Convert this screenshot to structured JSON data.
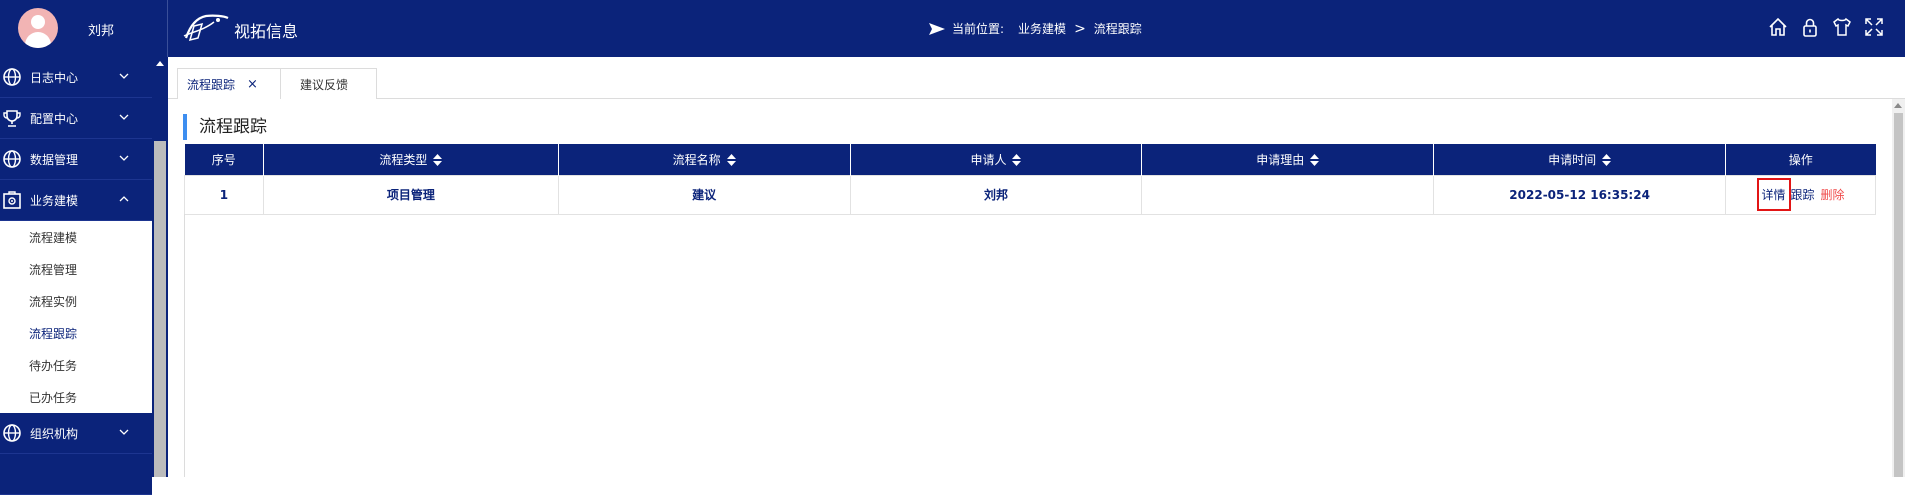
{
  "user": {
    "name": "刘邦"
  },
  "app": {
    "title": "视拓信息"
  },
  "breadcrumb": {
    "prefix": "当前位置:",
    "level1": "业务建模",
    "separator": ">",
    "level2": "流程跟踪"
  },
  "top_icons": [
    "home-icon",
    "lock-icon",
    "shirt-icon",
    "fullscreen-icon"
  ],
  "sidebar": {
    "groups": [
      {
        "label": "日志中心",
        "icon": "globe-icon"
      },
      {
        "label": "配置中心",
        "icon": "trophy-icon"
      },
      {
        "label": "数据管理",
        "icon": "globe-icon"
      },
      {
        "label": "业务建模",
        "icon": "gear-box-icon",
        "expanded": true
      },
      {
        "label": "组织机构",
        "icon": "globe-icon"
      }
    ],
    "sub_items": [
      {
        "label": "流程建模"
      },
      {
        "label": "流程管理"
      },
      {
        "label": "流程实例"
      },
      {
        "label": "流程跟踪",
        "active": true
      },
      {
        "label": "待办任务"
      },
      {
        "label": "已办任务"
      }
    ]
  },
  "tabs": [
    {
      "label": "流程跟踪",
      "active": true,
      "close": "×"
    },
    {
      "label": "建议反馈"
    }
  ],
  "page": {
    "title": "流程跟踪"
  },
  "table": {
    "headers": [
      "序号",
      "流程类型",
      "流程名称",
      "申请人",
      "申请理由",
      "申请时间",
      "操作"
    ],
    "rows": [
      {
        "index": "1",
        "type": "项目管理",
        "name": "建议",
        "applicant": "刘邦",
        "reason": "",
        "time": "2022-05-12 16:35:24"
      }
    ],
    "actions": {
      "detail": "详情",
      "track": "跟踪",
      "delete": "删除"
    }
  },
  "colors": {
    "brand": "#0b237a",
    "accent": "#3d8ef0",
    "danger": "#f04b4b",
    "highlight": "#e21515"
  }
}
